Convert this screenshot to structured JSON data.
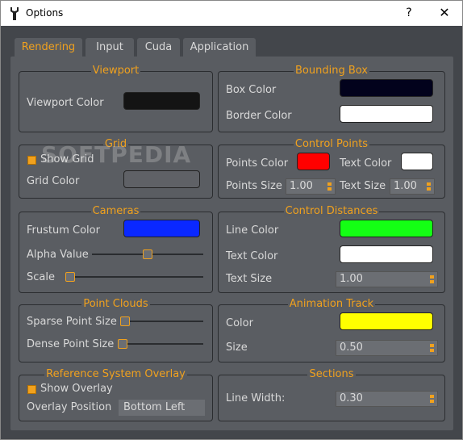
{
  "window": {
    "title": "Options",
    "help_label": "?",
    "close_label": "✕"
  },
  "tabs": [
    {
      "label": "Rendering",
      "active": true
    },
    {
      "label": "Input",
      "active": false
    },
    {
      "label": "Cuda",
      "active": false
    },
    {
      "label": "Application",
      "active": false
    }
  ],
  "viewport": {
    "title": "Viewport",
    "color_label": "Viewport Color",
    "color": "#141414"
  },
  "bounding_box": {
    "title": "Bounding Box",
    "box_color_label": "Box Color",
    "box_color": "#02021c",
    "border_color_label": "Border Color",
    "border_color": "#ffffff"
  },
  "grid": {
    "title": "Grid",
    "show_grid_label": "Show Grid",
    "show_grid_checked": true,
    "grid_color_label": "Grid Color",
    "grid_color": "#5f6166"
  },
  "control_points": {
    "title": "Control Points",
    "points_color_label": "Points Color",
    "points_color": "#ff0000",
    "text_color_label": "Text Color",
    "text_color": "#ffffff",
    "points_size_label": "Points Size",
    "points_size": "1.00",
    "text_size_label": "Text Size",
    "text_size": "1.00"
  },
  "cameras": {
    "title": "Cameras",
    "frustum_color_label": "Frustum Color",
    "frustum_color": "#0a28ff",
    "alpha_label": "Alpha Value",
    "alpha_value": 0.5,
    "scale_label": "Scale",
    "scale_value": 0.0
  },
  "control_distances": {
    "title": "Control Distances",
    "line_color_label": "Line Color",
    "line_color": "#14ff14",
    "text_color_label": "Text Color",
    "text_color": "#ffffff",
    "text_size_label": "Text Size",
    "text_size": "1.00"
  },
  "point_clouds": {
    "title": "Point Clouds",
    "sparse_label": "Sparse Point Size",
    "sparse_value": 0.0,
    "dense_label": "Dense Point Size",
    "dense_value": 0.0
  },
  "animation_track": {
    "title": "Animation Track",
    "color_label": "Color",
    "color": "#ffff00",
    "size_label": "Size",
    "size": "0.50"
  },
  "reference_system": {
    "title": "Reference System Overlay",
    "show_overlay_label": "Show Overlay",
    "show_overlay_checked": true,
    "position_label": "Overlay Position",
    "position_value": "Bottom Left"
  },
  "sections": {
    "title": "Sections",
    "line_width_label": "Line Width:",
    "line_width": "0.30"
  },
  "watermark": "SOFTPEDIA"
}
